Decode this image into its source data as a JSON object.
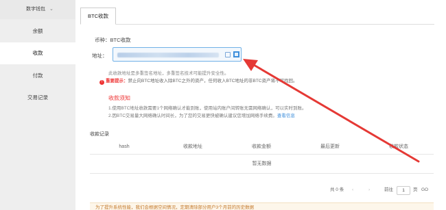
{
  "sidebar": {
    "header": "数字钱包",
    "items": [
      {
        "label": "余额"
      },
      {
        "label": "收款"
      },
      {
        "label": "付款"
      },
      {
        "label": "交易记录"
      }
    ]
  },
  "tabs": [
    {
      "label": "BTC收款"
    }
  ],
  "form": {
    "coin_label": "币种：BTC收款",
    "address_label": "地址："
  },
  "notes": {
    "multisig": "此收款地址是多重签名地址，多重签名技术可能提升安全性。",
    "warn_title": "重要提示：",
    "warn_text": "禁止向BTC地址收入除BTC之外的资产，任何收入BTC地址的非BTC资产将不可找回。"
  },
  "notice": {
    "title": "收款须知",
    "line1": "1.使用BTC地址收款需要1个网络确认才能到账，使用站内账户间转账无需网络确认，可以实时到账。",
    "line2": "2.因BTC交易量大网络确认时间长，为了您的交易更快被确认建议您增加网络手续费。",
    "link": "查看信息"
  },
  "records": {
    "title": "收款记录",
    "columns": [
      "hash",
      "收款地址",
      "收款金额",
      "最后更新",
      "收款状态"
    ],
    "empty": "暂无数据"
  },
  "pagination": {
    "total": "共 0 条",
    "goto": "前往",
    "page": "1",
    "page_unit": "页",
    "go": "GO"
  },
  "tip": "为了提升系统性能，我们会根据空间情况，定期清除部分用户3个月前的历史数据",
  "colors": {
    "accent": "#3d8edb",
    "warning": "#e33333",
    "arrow": "#e53935"
  }
}
